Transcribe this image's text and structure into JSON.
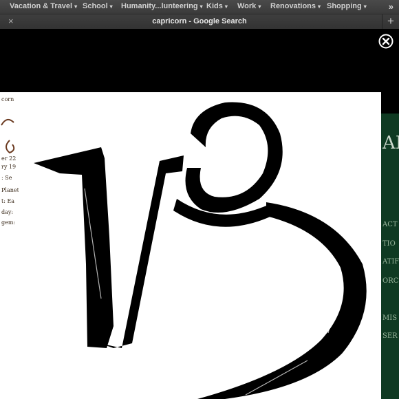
{
  "bookmarks": {
    "items": [
      {
        "label": "Vacation & Travel"
      },
      {
        "label": "School"
      },
      {
        "label": "Humanity...lunteering"
      },
      {
        "label": "Kids"
      },
      {
        "label": "Work"
      },
      {
        "label": "Renovations"
      },
      {
        "label": "Shopping"
      }
    ],
    "more_icon": "double-chevron-right-icon",
    "dropdown_glyph": "▾"
  },
  "tab": {
    "title": "capricorn - Google Search",
    "close_glyph": "×",
    "new_tab_glyph": "+"
  },
  "viewer": {
    "close_icon": "circle-x-icon",
    "left_thumb_text": [
      "corn",
      "er 22",
      "ry 19",
      ": Se",
      "Planet",
      "t: Ea",
      "day:",
      "gem:"
    ],
    "right_thumb_text": [
      "AP",
      "ACT",
      "TIO",
      "ATIF",
      "ORC",
      "MIS",
      "SER"
    ],
    "main_image": "capricorn-symbol-brush-stroke"
  }
}
